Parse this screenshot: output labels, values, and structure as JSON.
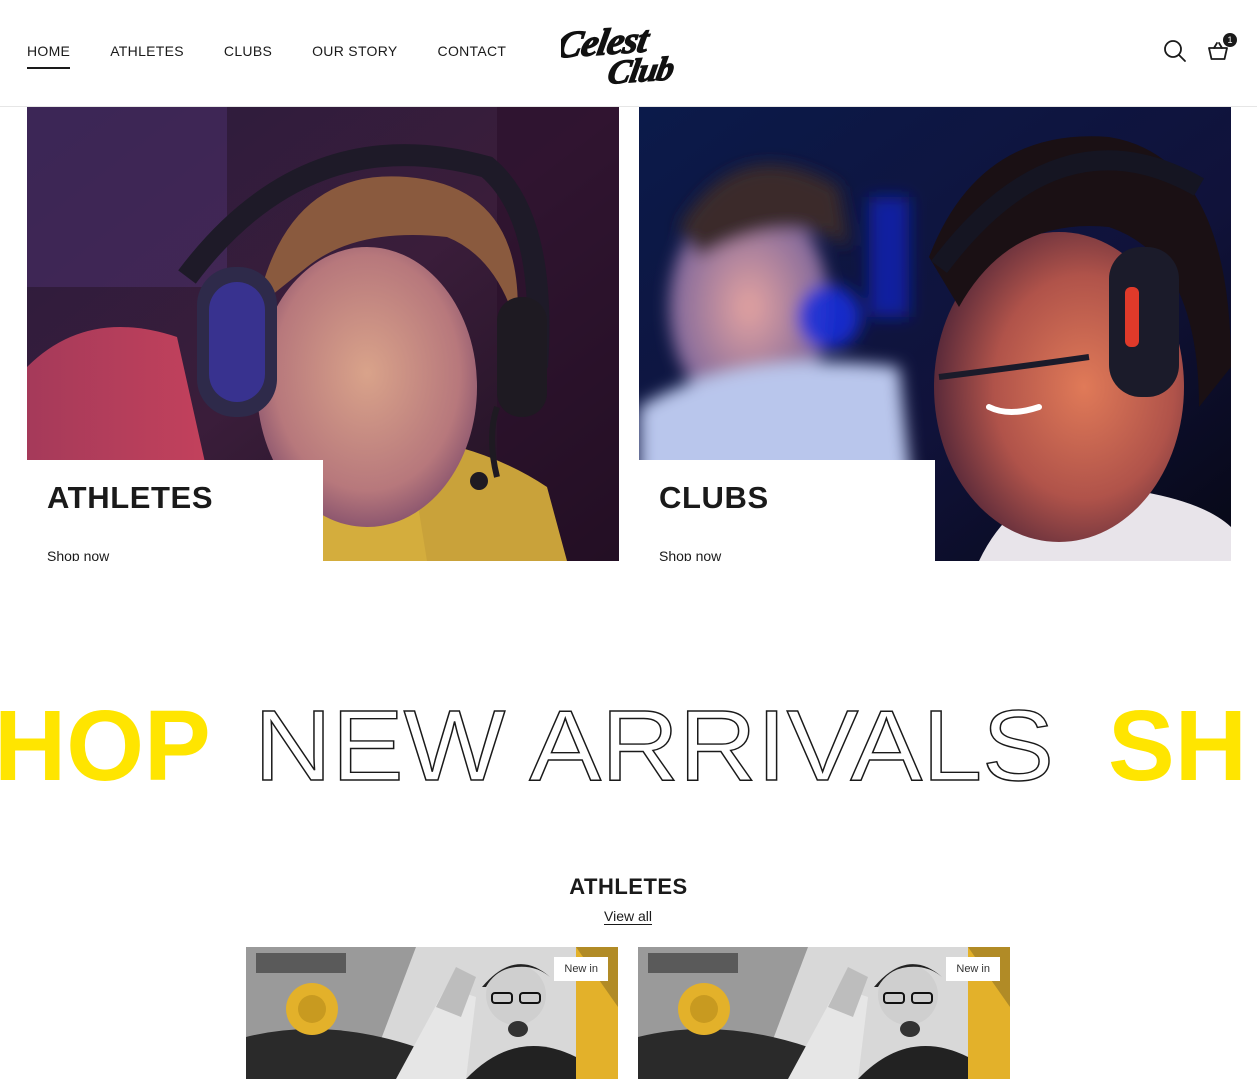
{
  "header": {
    "nav": [
      {
        "label": "HOME",
        "active": true
      },
      {
        "label": "ATHLETES",
        "active": false
      },
      {
        "label": "CLUBS",
        "active": false
      },
      {
        "label": "OUR STORY",
        "active": false
      },
      {
        "label": "CONTACT",
        "active": false
      }
    ],
    "logo_text": [
      "Celest",
      "Club"
    ],
    "icons": [
      "search-icon",
      "cart-icon"
    ],
    "cart_count": "1"
  },
  "categories": [
    {
      "title": "ATHLETES",
      "link": "Shop now"
    },
    {
      "title": "CLUBS",
      "link": "Shop now"
    }
  ],
  "marquee": {
    "left_text": "HOP",
    "outline_text": "NEW ARRIVALS",
    "right_text": "SH",
    "accent_color": "#FFE500"
  },
  "section": {
    "title": "ATHLETES",
    "view_all": "View all",
    "products": [
      {
        "badge": "New in"
      },
      {
        "badge": "New in"
      }
    ]
  }
}
